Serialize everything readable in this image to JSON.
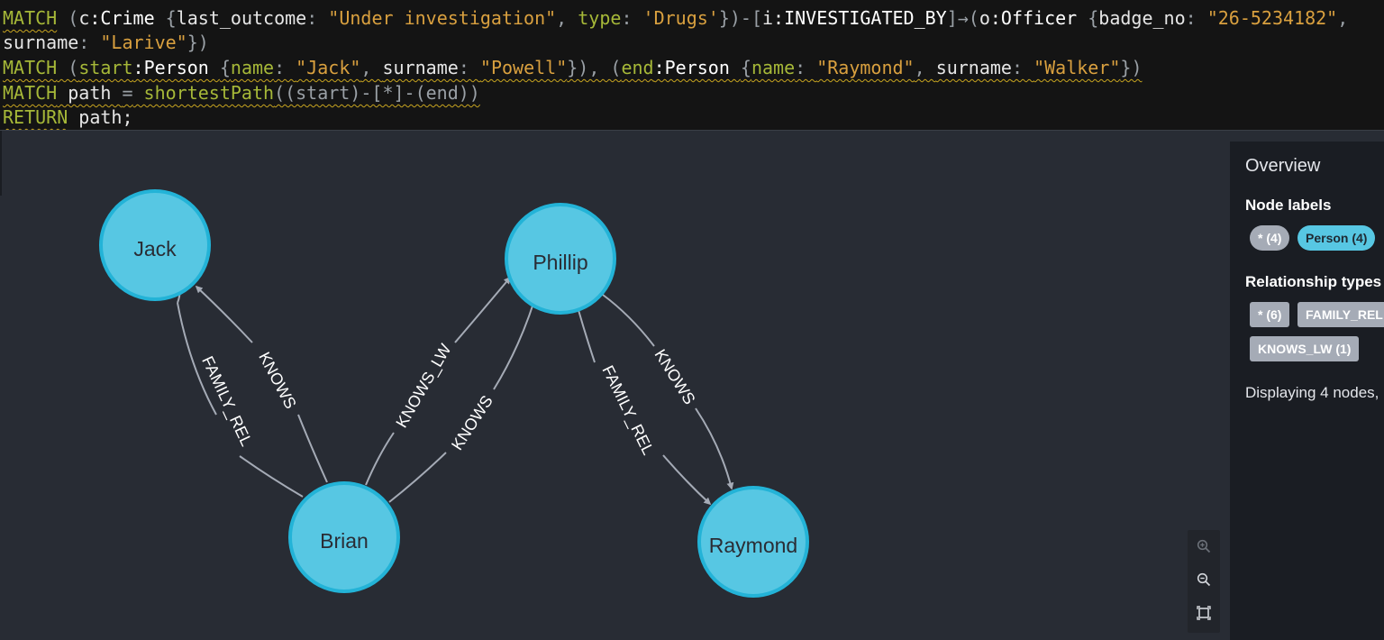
{
  "editor": {
    "line1": {
      "a": "MATCH",
      "b": " (",
      "c": "c",
      "d": ":Crime ",
      "e": "{",
      "f": "last_outcome",
      "g": ": ",
      "h": "\"Under investigation\"",
      "i": ", ",
      "j": "type",
      "k": ": ",
      "l": "'Drugs'",
      "m": "})-[",
      "n": "i",
      "o": ":INVESTIGATED_BY",
      "p": "]→(",
      "q": "o",
      "r": ":Officer ",
      "s": "{",
      "t": "badge_no",
      "u": ": ",
      "v": "\"26-5234182\"",
      "w": ","
    },
    "line2": {
      "a": "surname",
      "b": ": ",
      "c": "\"Larive\"",
      "d": "})"
    },
    "line3": {
      "a": "MATCH",
      "b": " (",
      "c": "start",
      "d": ":Person ",
      "e": "{",
      "f": "name",
      "g": ": ",
      "h": "\"Jack\"",
      "i": ", ",
      "j": "surname",
      "k": ": ",
      "l": "\"Powell\"",
      "m": "}), (",
      "n": "end",
      "o": ":Person ",
      "p": "{",
      "q": "name",
      "r": ": ",
      "s": "\"Raymond\"",
      "t": ", ",
      "u": "surname",
      "v": ": ",
      "w": "\"Walker\"",
      "x": "})"
    },
    "line4": {
      "a": "MATCH",
      "b": " path ",
      "c": "=",
      "d": " shortestPath",
      "e": "((start)-[*]-(end))"
    },
    "line5": {
      "a": "RETURN",
      "b": " path;"
    }
  },
  "graph": {
    "node_color": "#57c7e3",
    "node_border": "#23b3d7",
    "edge_color": "#a5abb6",
    "nodes": {
      "jack": "Jack",
      "phillip": "Phillip",
      "brian": "Brian",
      "raymond": "Raymond"
    },
    "edges": {
      "brian_jack_family": "FAMILY_REL",
      "brian_jack_knows": "KNOWS",
      "brian_phillip_knows_lw": "KNOWS_LW",
      "brian_phillip_knows": "KNOWS",
      "phillip_raymond_family": "FAMILY_REL",
      "phillip_raymond_knows": "KNOWS"
    }
  },
  "zoom": {
    "icons": [
      "zoom-in-icon",
      "zoom-out-icon",
      "fit-to-screen-icon"
    ]
  },
  "sidebar": {
    "title": "Overview",
    "node_labels_heading": "Node labels",
    "node_labels": [
      {
        "label": "* (4)",
        "color": "#a5abb6"
      },
      {
        "label": "Person (4)",
        "color": "#57c7e3"
      }
    ],
    "rel_types_heading": "Relationship types",
    "rel_types": [
      "* (6)",
      "FAMILY_REL",
      "KNOWS_LW (1)"
    ],
    "status": "Displaying 4 nodes,"
  }
}
